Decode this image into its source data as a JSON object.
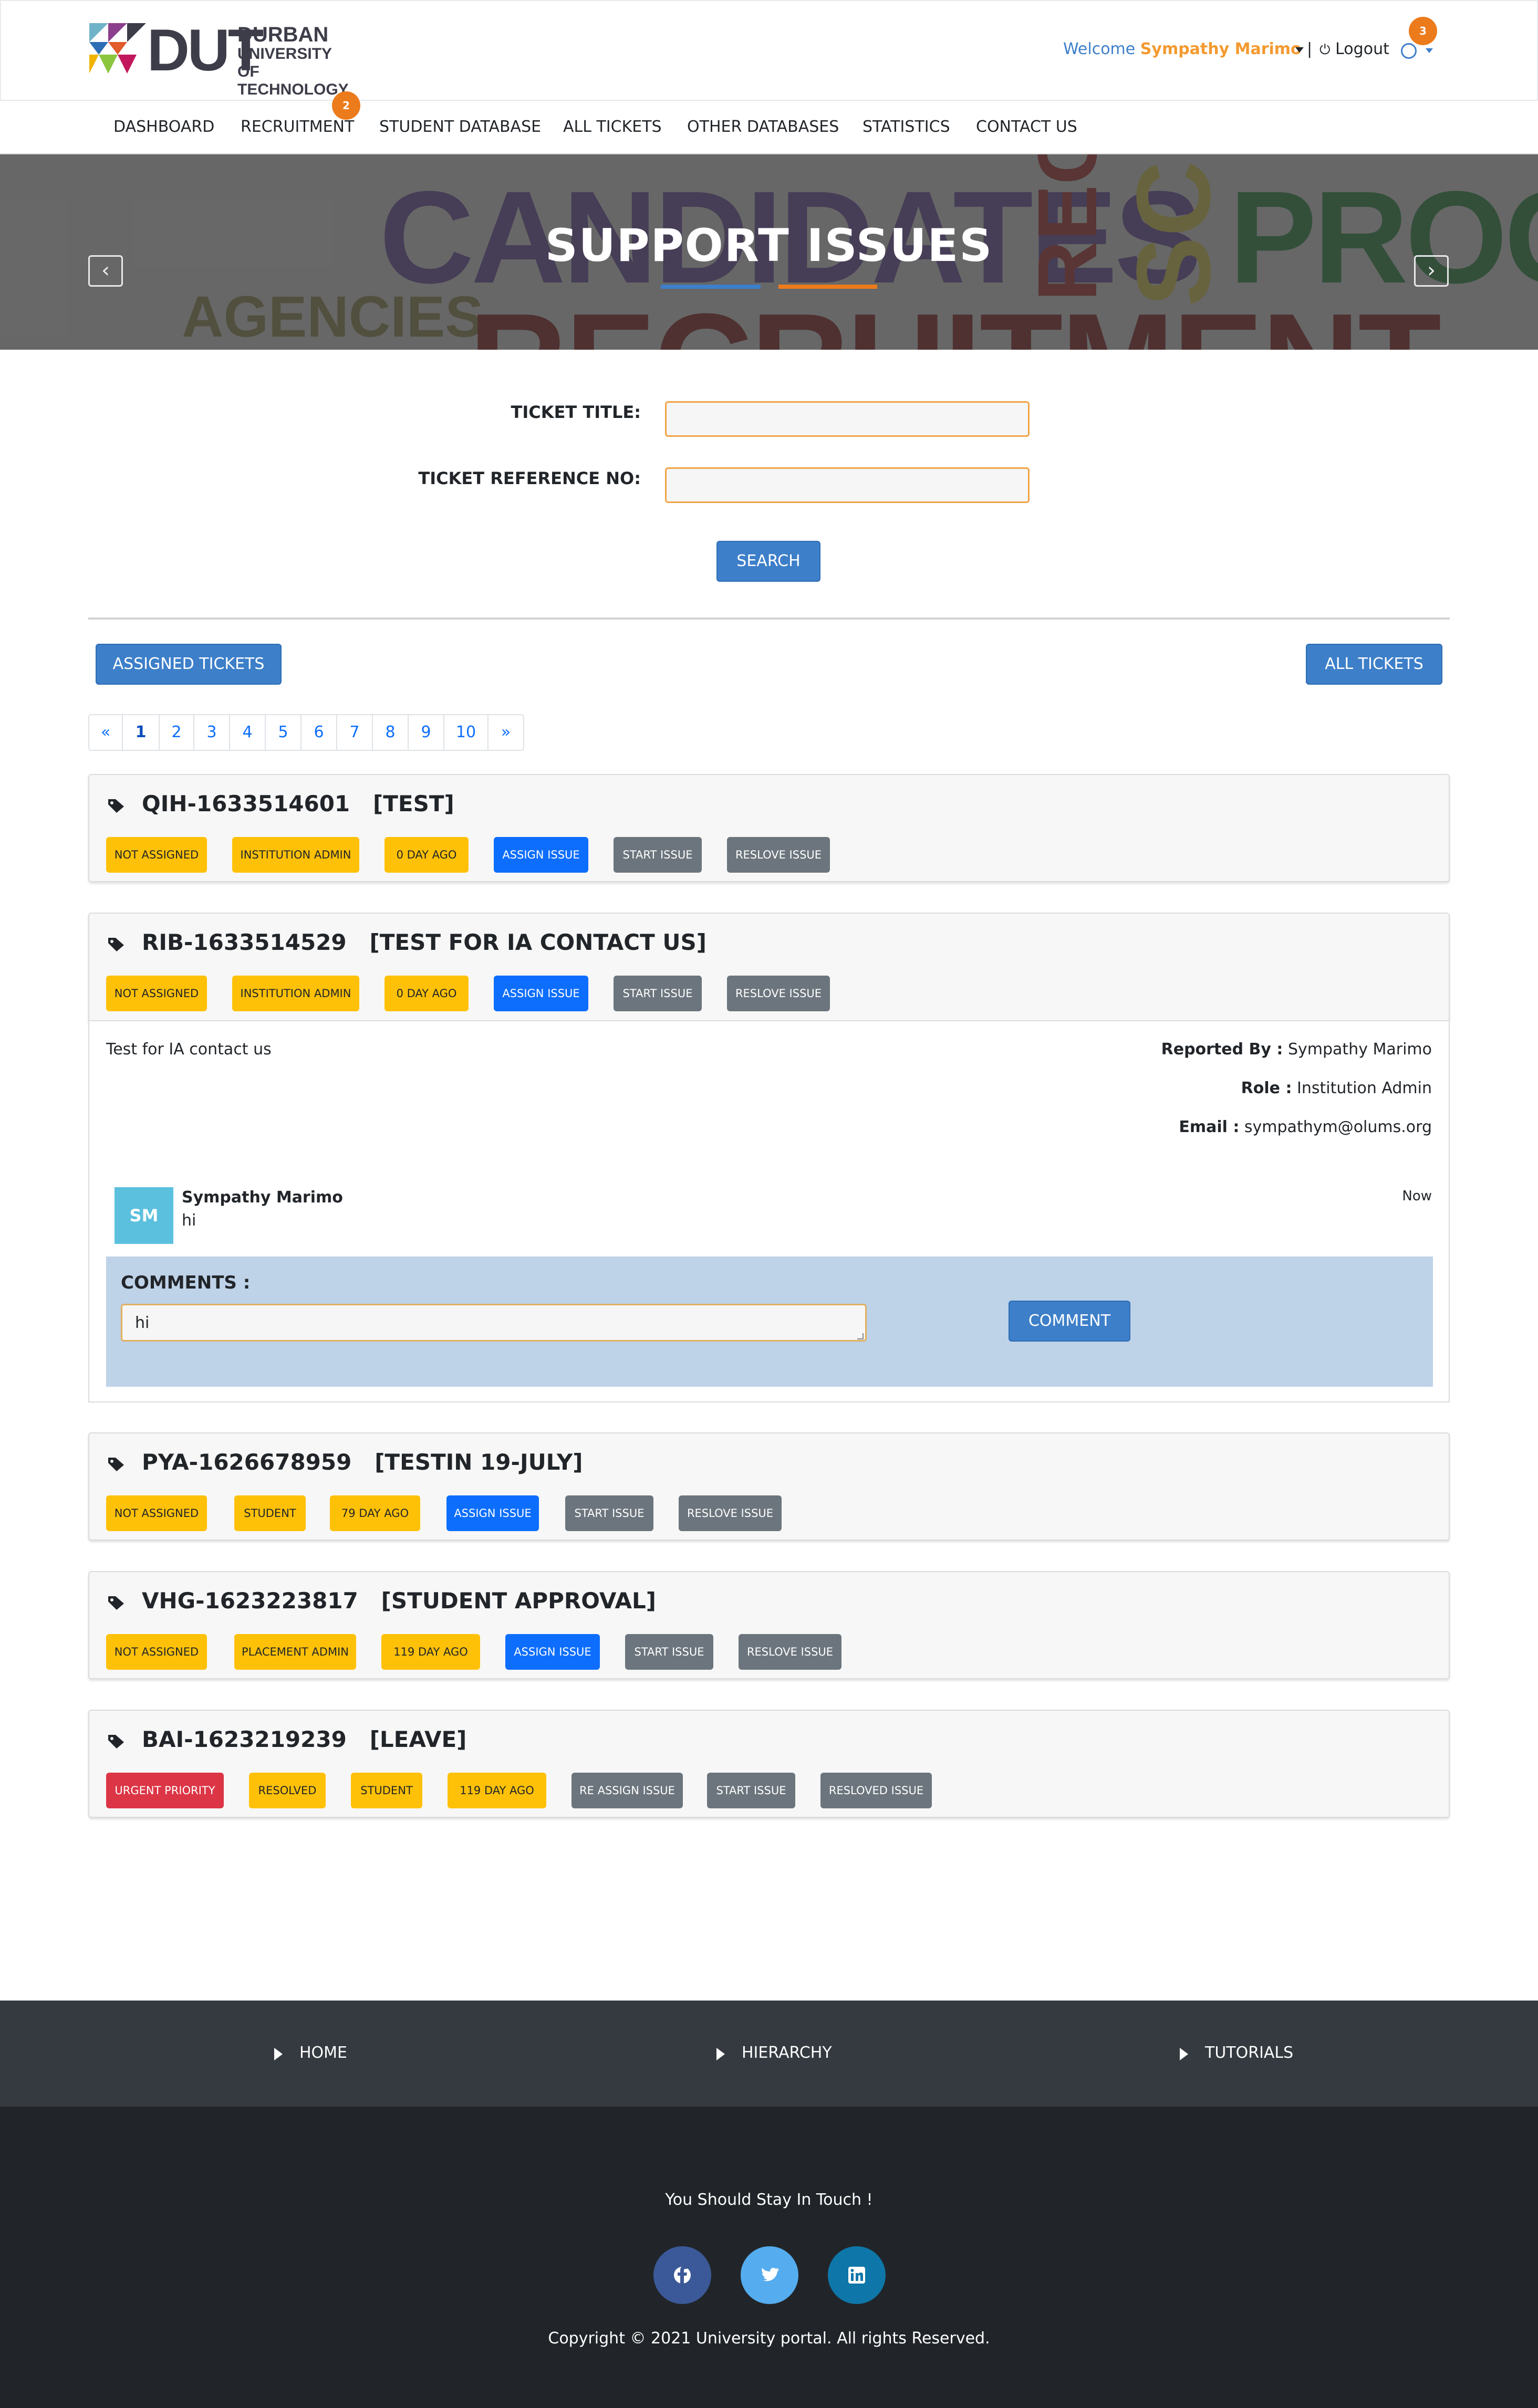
{
  "header": {
    "logo_main": "DUT",
    "logo_sub": [
      "DURBAN",
      "UNIVERSITY OF",
      "TECHNOLOGY"
    ],
    "welcome_prefix": "Welcome",
    "user_name": "Sympathy Marimo",
    "separator": "|",
    "logout": "Logout",
    "notifications": "3"
  },
  "nav": {
    "items": [
      "DASHBOARD",
      "RECRUITMENT",
      "STUDENT DATABASE",
      "ALL TICKETS",
      "OTHER DATABASES",
      "STATISTICS",
      "CONTACT US"
    ],
    "recruitment_badge": "2"
  },
  "banner": {
    "title": "SUPPORT ISSUES",
    "bg_words": [
      "CANDIDATES",
      "REC",
      "SC",
      "PROCE",
      "AGENCIES",
      "RECRUITMENT"
    ],
    "prev": "‹",
    "next": "›"
  },
  "search": {
    "title_label": "TICKET TITLE:",
    "title_value": "",
    "ref_label": "TICKET REFERENCE NO:",
    "ref_value": "",
    "button": "SEARCH"
  },
  "filters": {
    "assigned": "ASSIGNED TICKETS",
    "all": "ALL TICKETS"
  },
  "pagination": [
    "«",
    "1",
    "2",
    "3",
    "4",
    "5",
    "6",
    "7",
    "8",
    "9",
    "10",
    "»"
  ],
  "tickets": [
    {
      "ref": "QIH-1633514601",
      "title": "[TEST]",
      "badges": [
        "NOT ASSIGNED",
        "INSTITUTION ADMIN",
        "0   DAY AGO"
      ],
      "actions": [
        "ASSIGN ISSUE",
        "START ISSUE",
        "RESLOVE ISSUE"
      ]
    },
    {
      "ref": "RIB-1633514529",
      "title": "[TEST FOR IA CONTACT US]",
      "badges": [
        "NOT ASSIGNED",
        "INSTITUTION ADMIN",
        "0   DAY AGO"
      ],
      "actions": [
        "ASSIGN ISSUE",
        "START ISSUE",
        "RESLOVE ISSUE"
      ],
      "description": "Test for IA contact us",
      "reported_by_label": "Reported By :",
      "reported_by": "Sympathy Marimo",
      "role_label": "Role :",
      "role": "Institution Admin",
      "email_label": "Email :",
      "email": "sympathym@olums.org",
      "comment": {
        "initials": "SM",
        "author": "Sympathy Marimo",
        "text": "hi",
        "time": "Now"
      },
      "comments_label": "COMMENTS :",
      "comment_input": "hi",
      "comment_button": "COMMENT"
    },
    {
      "ref": "PYA-1626678959",
      "title": "[TESTIN 19-JULY]",
      "badges": [
        "NOT ASSIGNED",
        "STUDENT",
        "79   DAY AGO"
      ],
      "actions": [
        "ASSIGN ISSUE",
        "START ISSUE",
        "RESLOVE ISSUE"
      ]
    },
    {
      "ref": "VHG-1623223817",
      "title": "[STUDENT APPROVAL]",
      "badges": [
        "NOT ASSIGNED",
        "PLACEMENT ADMIN",
        "119   DAY AGO"
      ],
      "actions": [
        "ASSIGN ISSUE",
        "START ISSUE",
        "RESLOVE ISSUE"
      ]
    },
    {
      "ref": "BAI-1623219239",
      "title": "[LEAVE]",
      "badges": [
        "URGENT PRIORITY",
        "RESOLVED",
        "STUDENT",
        "119   DAY AGO"
      ],
      "actions": [
        "RE ASSIGN ISSUE",
        "START ISSUE",
        "RESLOVED ISSUE"
      ]
    }
  ],
  "footer": {
    "links": [
      "HOME",
      "HIERARCHY",
      "TUTORIALS"
    ],
    "stay": "You Should Stay In Touch !",
    "social": [
      "facebook-icon",
      "twitter-icon",
      "linkedin-icon"
    ],
    "copyright": "Copyright © 2021 University portal. All rights Reserved."
  },
  "colors": {
    "primary": "#3d7fc9",
    "accent": "#f39a30",
    "warning": "#ffc107",
    "assign": "#0d6efd",
    "secondary": "#6c757d",
    "danger": "#dc3545"
  }
}
